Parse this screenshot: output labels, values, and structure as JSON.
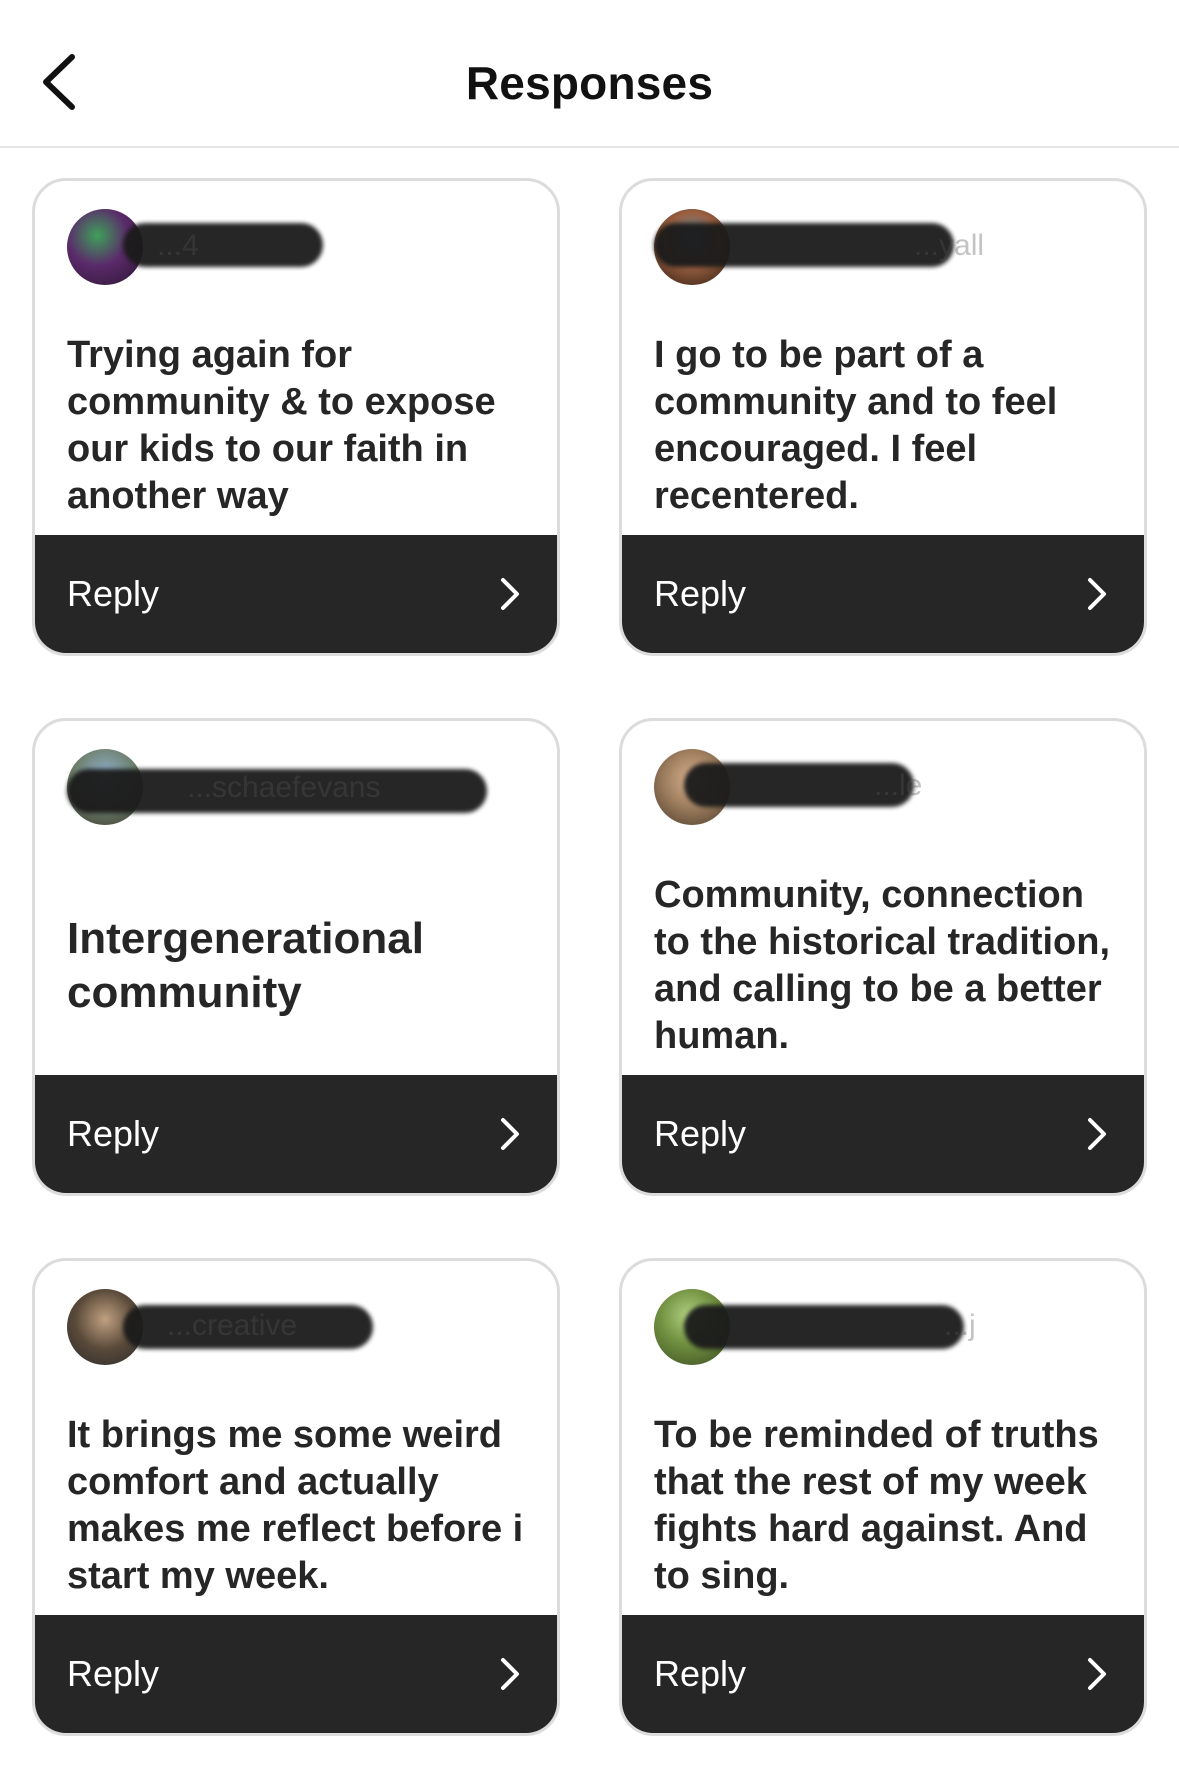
{
  "header": {
    "title": "Responses",
    "back_icon": "chevron-left-icon"
  },
  "responses": [
    {
      "username": "...4",
      "avatar_color": "#7a2a6f",
      "text": "Trying again for community & to expose our kids to our faith in another way",
      "reply_label": "Reply"
    },
    {
      "username": "...yall",
      "avatar_color": "#8a5a3a",
      "text": "I go to be part of a community and to feel encouraged. I feel recentered.",
      "reply_label": "Reply"
    },
    {
      "username": "...schaefevans",
      "avatar_color": "#6d7f6a",
      "text": "Intergenerational community",
      "reply_label": "Reply"
    },
    {
      "username": "...le",
      "avatar_color": "#a08060",
      "text": "Community, connection to the historical tradition, and calling to be a better human.",
      "reply_label": "Reply"
    },
    {
      "username": "...creative",
      "avatar_color": "#5a4a3a",
      "text": "It brings me some weird comfort and actually makes me reflect before i start my week.",
      "reply_label": "Reply"
    },
    {
      "username": "...j",
      "avatar_color": "#6f8f3f",
      "text": "To be reminded of truths that the rest of my week fights hard against. And to sing.",
      "reply_label": "Reply"
    }
  ]
}
